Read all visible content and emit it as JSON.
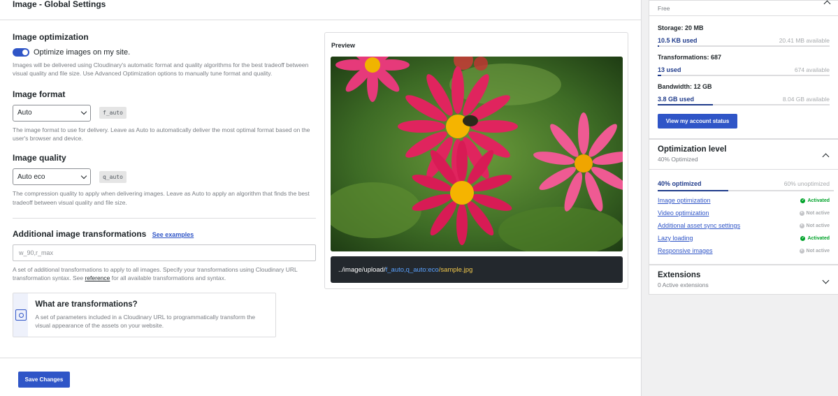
{
  "header": {
    "title": "Image - Global Settings"
  },
  "optimization": {
    "title": "Image optimization",
    "toggle_label": "Optimize images on my site.",
    "help": "Images will be delivered using Cloudinary's automatic format and quality algorithms for the best tradeoff between visual quality and file size. Use Advanced Optimization options to manually tune format and quality."
  },
  "format": {
    "title": "Image format",
    "selected": "Auto",
    "code": "f_auto",
    "help": "The image format to use for delivery. Leave as Auto to automatically deliver the most optimal format based on the user's browser and device."
  },
  "quality": {
    "title": "Image quality",
    "selected": "Auto eco",
    "code": "q_auto",
    "help": "The compression quality to apply when delivering images. Leave as Auto to apply an algorithm that finds the best tradeoff between visual quality and file size."
  },
  "transformations": {
    "title": "Additional image transformations",
    "examples_link": "See examples",
    "placeholder": "w_90,r_max",
    "help_before": "A set of additional transformations to apply to all images. Specify your transformations using Cloudinary URL transformation syntax. See",
    "help_link": "reference",
    "help_after": "for all available transformations and syntax."
  },
  "info": {
    "title": "What are transformations?",
    "text": "A set of parameters included in a Cloudinary URL to programmatically transform the visual appearance of the assets on your website."
  },
  "preview": {
    "label": "Preview",
    "url_base": "../image/upload/",
    "url_params": "f_auto,q_auto:eco",
    "url_file": "/sample.jpg"
  },
  "save_label": "Save Changes",
  "account": {
    "plan": "Free",
    "usage": [
      {
        "title": "Storage: 20 MB",
        "used": "10.5 KB used",
        "available": "20.41 MB available",
        "fraction": 0.01
      },
      {
        "title": "Transformations: 687",
        "used": "13 used",
        "available": "674 available",
        "fraction": 0.02
      },
      {
        "title": "Bandwidth: 12 GB",
        "used": "3.8 GB used",
        "available": "8.04 GB available",
        "fraction": 0.32
      }
    ],
    "status_button": "View my account status"
  },
  "optimization_level": {
    "title": "Optimization level",
    "subtitle": "40% Optimized",
    "optimized": "40% optimized",
    "unoptimized": "60% unoptimized",
    "fraction": 0.4,
    "items": [
      {
        "label": "Image optimization",
        "status": "Activated"
      },
      {
        "label": "Video optimization",
        "status": "Not active"
      },
      {
        "label": "Additional asset sync settings",
        "status": "Not active"
      },
      {
        "label": "Lazy loading",
        "status": "Activated"
      },
      {
        "label": "Responsive images",
        "status": "Not active"
      }
    ]
  },
  "extensions": {
    "title": "Extensions",
    "subtitle": "0 Active extensions"
  },
  "colors": {
    "accent": "#2f55c7",
    "active": "#00a32a",
    "inactive": "#a7aaad",
    "code_bg": "#23282d"
  }
}
